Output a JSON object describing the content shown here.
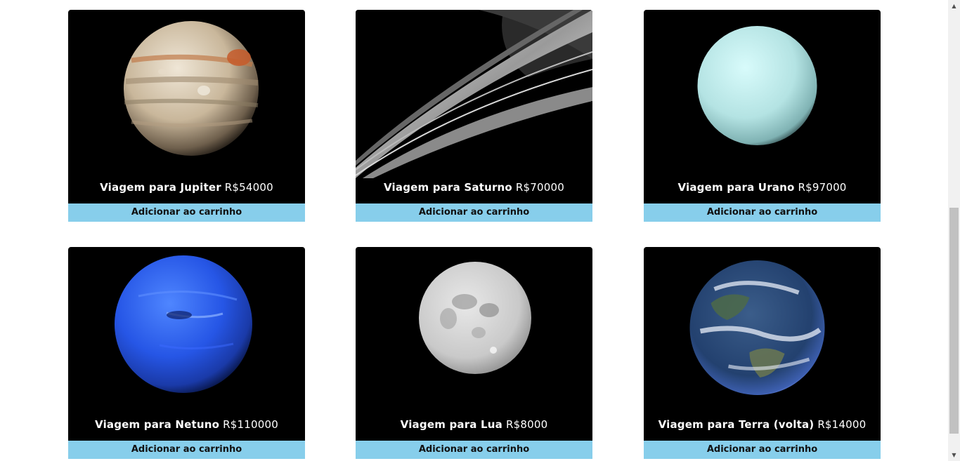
{
  "products": [
    {
      "name": "Viagem para Jupiter",
      "price": "R$54000",
      "button": "Adicionar ao carrinho",
      "image": "jupiter"
    },
    {
      "name": "Viagem para Saturno",
      "price": "R$70000",
      "button": "Adicionar ao carrinho",
      "image": "saturn"
    },
    {
      "name": "Viagem para Urano",
      "price": "R$97000",
      "button": "Adicionar ao carrinho",
      "image": "uranus"
    },
    {
      "name": "Viagem para Netuno",
      "price": "R$110000",
      "button": "Adicionar ao carrinho",
      "image": "neptune"
    },
    {
      "name": "Viagem para Lua",
      "price": "R$8000",
      "button": "Adicionar ao carrinho",
      "image": "moon"
    },
    {
      "name": "Viagem para Terra (volta)",
      "price": "R$14000",
      "button": "Adicionar ao carrinho",
      "image": "earth"
    }
  ],
  "colors": {
    "button": "#87ceeb",
    "card": "#000000"
  },
  "scrollbar": {
    "up_icon": "chevron-up-icon",
    "down_icon": "chevron-down-icon"
  }
}
